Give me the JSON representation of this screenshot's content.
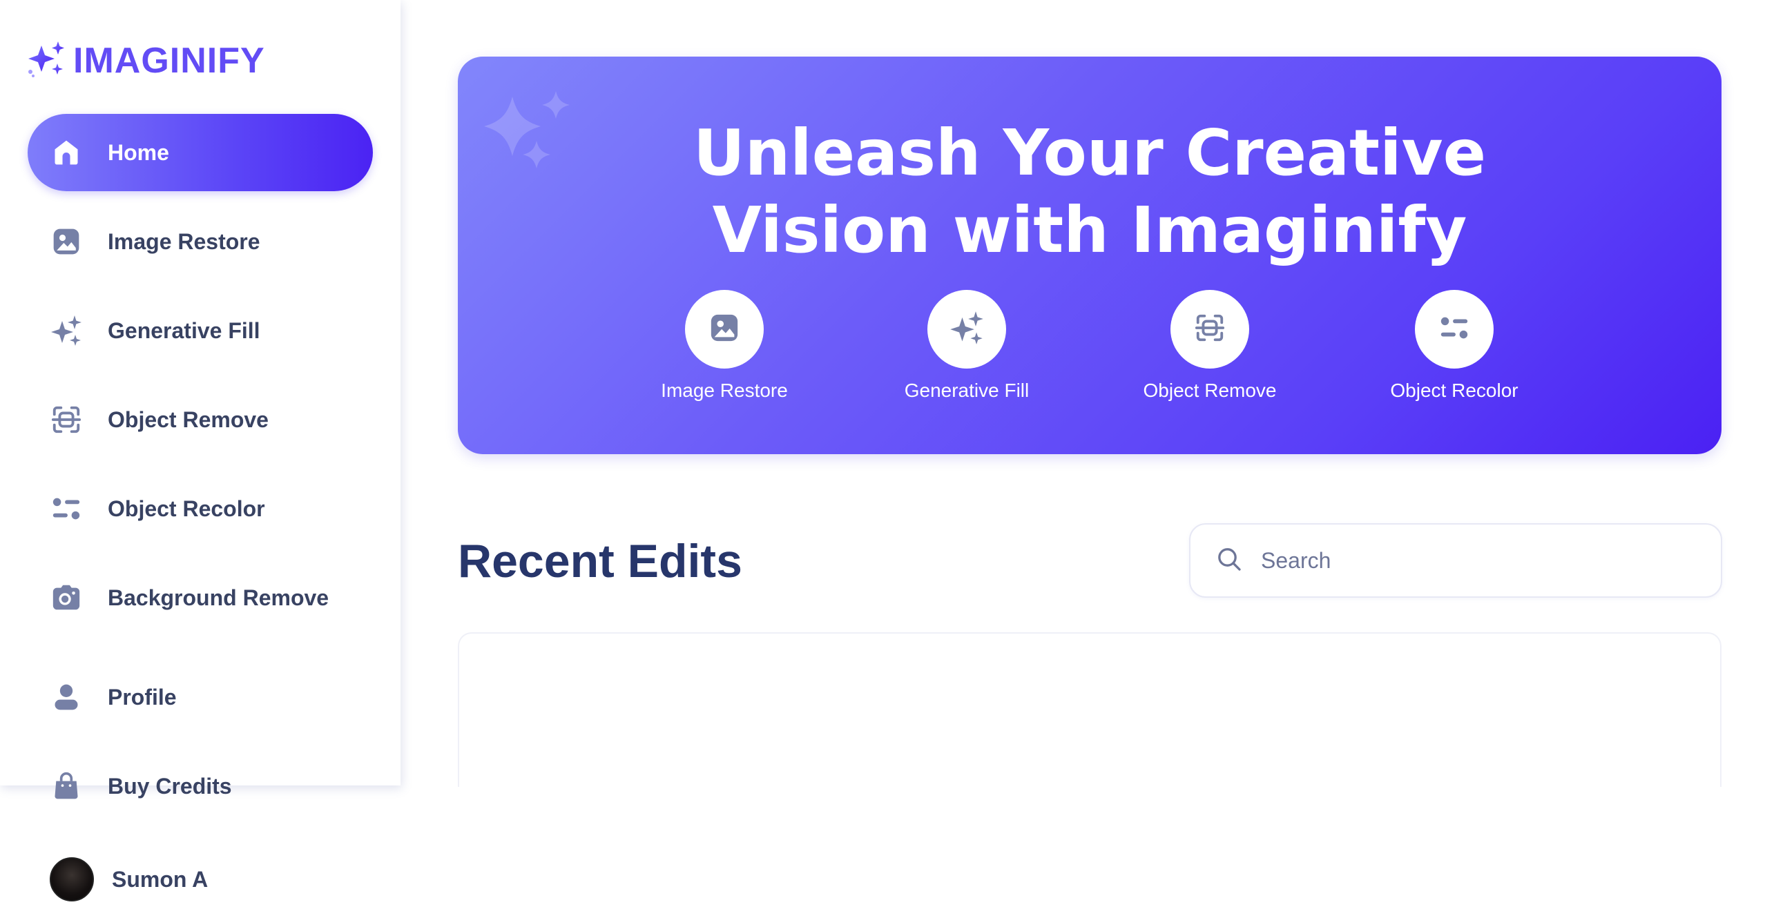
{
  "brand": {
    "name": "IMAGINIFY",
    "icon": "sparkle-logo-icon",
    "color": "#624cf5"
  },
  "sidebar": {
    "items": [
      {
        "label": "Home",
        "icon": "home-icon",
        "active": true
      },
      {
        "label": "Image Restore",
        "icon": "image-icon",
        "active": false
      },
      {
        "label": "Generative Fill",
        "icon": "sparkles-icon",
        "active": false
      },
      {
        "label": "Object Remove",
        "icon": "scan-icon",
        "active": false
      },
      {
        "label": "Object Recolor",
        "icon": "filter-icon",
        "active": false
      },
      {
        "label": "Background Remove",
        "icon": "camera-icon",
        "active": false
      },
      {
        "label": "Profile",
        "icon": "user-icon",
        "active": false
      },
      {
        "label": "Buy Credits",
        "icon": "bag-icon",
        "active": false
      }
    ],
    "user": {
      "name": "Sumon A"
    }
  },
  "banner": {
    "title_line1": "Unleash Your Creative",
    "title_line2": "Vision with Imaginify",
    "tools": [
      {
        "label": "Image Restore",
        "icon": "image-icon"
      },
      {
        "label": "Generative Fill",
        "icon": "sparkles-icon"
      },
      {
        "label": "Object Remove",
        "icon": "scan-icon"
      },
      {
        "label": "Object Recolor",
        "icon": "filter-icon"
      }
    ]
  },
  "recent": {
    "title": "Recent Edits",
    "search_placeholder": "Search"
  },
  "colors": {
    "accent": "#624cf5",
    "nav_text": "#384262",
    "heading": "#27366b",
    "icon_gray": "#7680a6"
  }
}
